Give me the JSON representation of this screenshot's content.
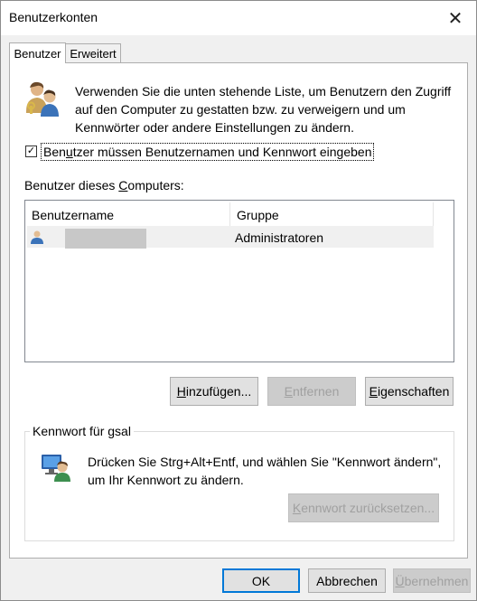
{
  "window": {
    "title": "Benutzerkonten",
    "close_glyph": "✕"
  },
  "tabs": [
    {
      "label": "Benutzer",
      "active": true
    },
    {
      "label": "Erweitert",
      "active": false
    }
  ],
  "intro": {
    "icon": "users-icon",
    "text": "Verwenden Sie die unten stehende Liste, um Benutzern den Zugriff auf den Computer zu gestatten bzw. zu verweigern und um Kennwörter oder andere Einstellungen zu ändern."
  },
  "require_login": {
    "checked": true,
    "check_glyph": "✓",
    "label_pre": "Ben",
    "label_accel": "u",
    "label_post": "tzer müssen Benutzernamen und Kennwort eingeben"
  },
  "users_section": {
    "label_pre": "Benutzer dieses ",
    "label_accel": "C",
    "label_post": "omputers:",
    "columns": [
      "Benutzername",
      "Gruppe"
    ],
    "rows": [
      {
        "username": "",
        "group": "Administratoren"
      }
    ]
  },
  "buttons": {
    "add": {
      "accel": "H",
      "rest": "inzufügen..."
    },
    "remove": {
      "accel": "E",
      "rest": "ntfernen"
    },
    "properties": {
      "accel": "E",
      "rest": "igenschaften"
    }
  },
  "password_group": {
    "legend": "Kennwort für gsal",
    "icon": "user-password-icon",
    "text": "Drücken Sie Strg+Alt+Entf, und wählen Sie \"Kennwort ändern\", um Ihr Kennwort zu ändern.",
    "reset": {
      "accel": "K",
      "rest": "ennwort zurücksetzen..."
    }
  },
  "footer": {
    "ok": "OK",
    "cancel": "Abbrechen",
    "apply": {
      "accel": "Ü",
      "rest": "bernehmen"
    }
  },
  "colors": {
    "accent": "#0078d7",
    "dialog_bg": "#f0f0f0",
    "disabled_text": "#a0a0a0"
  }
}
